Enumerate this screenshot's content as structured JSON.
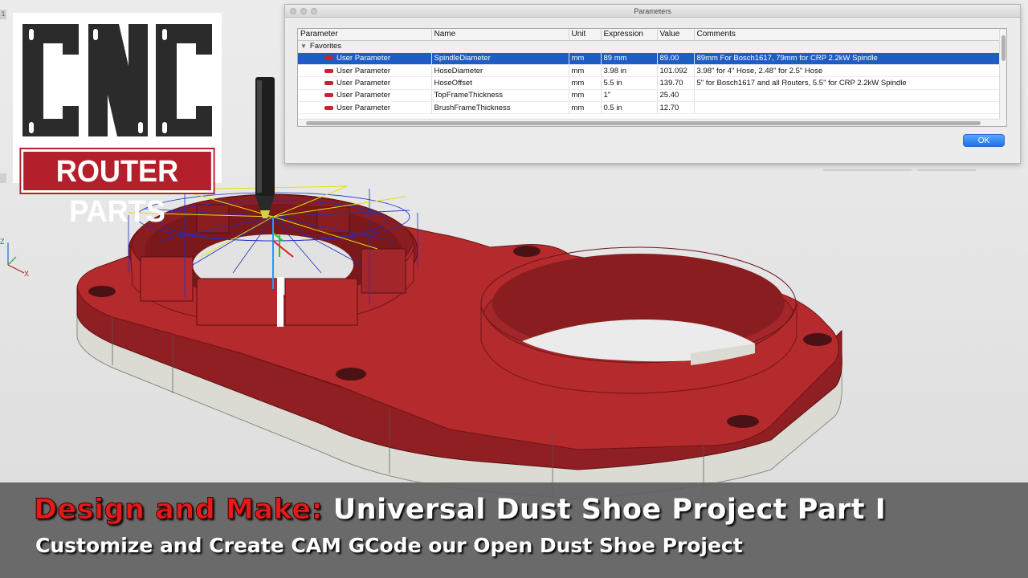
{
  "logo": {
    "letters": "CNC",
    "banner": "ROUTER PARTS"
  },
  "dialog": {
    "title": "Parameters",
    "columns": [
      "Parameter",
      "Name",
      "Unit",
      "Expression",
      "Value",
      "Comments"
    ],
    "group_label": "Favorites",
    "rows": [
      {
        "parameter": "User Parameter",
        "name": "SpindleDiameter",
        "unit": "mm",
        "expression": "89 mm",
        "value": "89.00",
        "comment": "89mm For Bosch1617, 79mm for CRP 2.2kW Spindle"
      },
      {
        "parameter": "User Parameter",
        "name": "HoseDiameter",
        "unit": "mm",
        "expression": "3.98 in",
        "value": "101.092",
        "comment": "3.98\" for 4\" Hose, 2.48\" for 2.5\" Hose"
      },
      {
        "parameter": "User Parameter",
        "name": "HoseOffset",
        "unit": "mm",
        "expression": "5.5 in",
        "value": "139.70",
        "comment": "5\" for Bosch1617 and all Routers, 5.5\" for CRP 2.2kW Spindle"
      },
      {
        "parameter": "User Parameter",
        "name": "TopFrameThickness",
        "unit": "mm",
        "expression": "1\"",
        "value": "25.40",
        "comment": ""
      },
      {
        "parameter": "User Parameter",
        "name": "BrushFrameThickness",
        "unit": "mm",
        "expression": "0.5 in",
        "value": "12.70",
        "comment": ""
      }
    ],
    "ok_label": "OK"
  },
  "caption": {
    "part1_red": "Design and Make:",
    "part1_white": " Universal Dust Shoe Project Part I",
    "line2": "Customize and Create CAM GCode our Open Dust Shoe Project"
  },
  "axis": {
    "x_label": "X",
    "z_label": "Z"
  },
  "colors": {
    "part_red": "#b52a2c",
    "part_white": "#dcdbd3",
    "selection": "#1e5cc6",
    "caption_red": "#e41b1b"
  }
}
